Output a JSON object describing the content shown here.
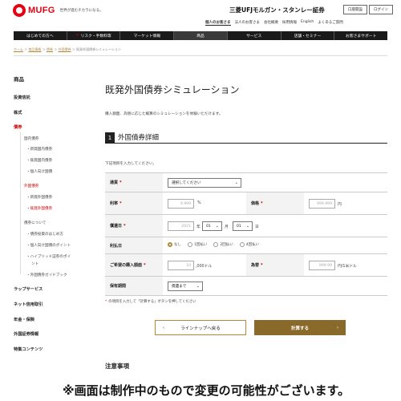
{
  "header": {
    "logo_text": "MUFG",
    "tagline": "世界が進むチカラになる。",
    "brand": "三菱UFJモルガン・スタンレー証券",
    "btn_open_account": "口座開設",
    "btn_login": "ログイン",
    "links": [
      "個人のお客さま",
      "法人のお客さま",
      "会社概要",
      "採用情報",
      "English",
      "よくあるご質問"
    ]
  },
  "nav": [
    {
      "label": "はじめての方へ",
      "cross": ""
    },
    {
      "label": "リスク・手数料等",
      "cross": "✕"
    },
    {
      "label": "マーケット情報",
      "cross": ""
    },
    {
      "label": "商品",
      "cross": ""
    },
    {
      "label": "サービス",
      "cross": ""
    },
    {
      "label": "店舗・セミナー",
      "cross": ""
    },
    {
      "label": "お客さまサポート",
      "cross": ""
    }
  ],
  "breadcrumb": {
    "items": [
      "ホーム",
      "商品情報",
      "債券",
      "外国債券"
    ],
    "current": "既発外国債券シミュレーション"
  },
  "sidebar": {
    "heading": "商品",
    "investment_trust": "投資信託",
    "stocks": "株式",
    "bonds": "債券",
    "domestic_bonds": "国内債券",
    "domestic_new": "・新発国内債券",
    "domestic_existing": "・既発国内債券",
    "domestic_personal": "・個人向け国債",
    "foreign_bonds": "外国債券",
    "foreign_new": "・新発外国債券",
    "foreign_existing": "・既発外国債券",
    "about_bonds": "債券について",
    "about_start": "・債券投資のはじめ方",
    "about_personal_points": "・個人向け国債のポイント",
    "about_hybrid_1": "・ハイブリッド証券のポイ",
    "about_hybrid_2": "ント",
    "about_guide": "・外国債券ガイドブック",
    "wrap": "ラップサービス",
    "net_credit": "ネット信用取引",
    "pension": "年金・保険",
    "foreign_securities": "外国証券情報",
    "special": "特集コンテンツ"
  },
  "page_title": "既発外国債券シミュレーション",
  "description": "購入額面、為替に応じた概算のシミュレーションを体験いただけます。",
  "section": {
    "number": "1",
    "title": "外国債券詳細"
  },
  "instruction": "下記項目を入力してください。",
  "form": {
    "currency_label": "通貨",
    "currency_value": "選択してください",
    "rate_label": "利率",
    "rate_placeholder": "9.999",
    "rate_unit": "%",
    "price_label": "価格",
    "price_placeholder": "999.999",
    "price_unit": "円",
    "maturity_label": "償還日",
    "year_placeholder": "2021",
    "year_unit": "年",
    "month_value": "01",
    "month_unit": "月",
    "day_value": "01",
    "day_unit": "日",
    "payment_label": "利払日",
    "payment_options": [
      "なし",
      "1回払い",
      "2回払い",
      "4回払い"
    ],
    "payment_selected": 0,
    "amount_label": "ご希望の購入額面",
    "amount_placeholder": "10",
    "amount_unit": ",000ドル",
    "fx_label": "為替",
    "fx_placeholder": "999.99",
    "fx_unit": "円/1米ドル",
    "holding_label": "保有期間",
    "holding_value": "償還まで",
    "required_mark": "*"
  },
  "form_note": "の項目を入力して「計算する」ボタンを押してください",
  "buttons": {
    "back": "ラインナップへ戻る",
    "calculate": "計算する"
  },
  "caution_heading": "注意事項",
  "banner": "※画面は制作中のもので変更の可能性がございます。"
}
